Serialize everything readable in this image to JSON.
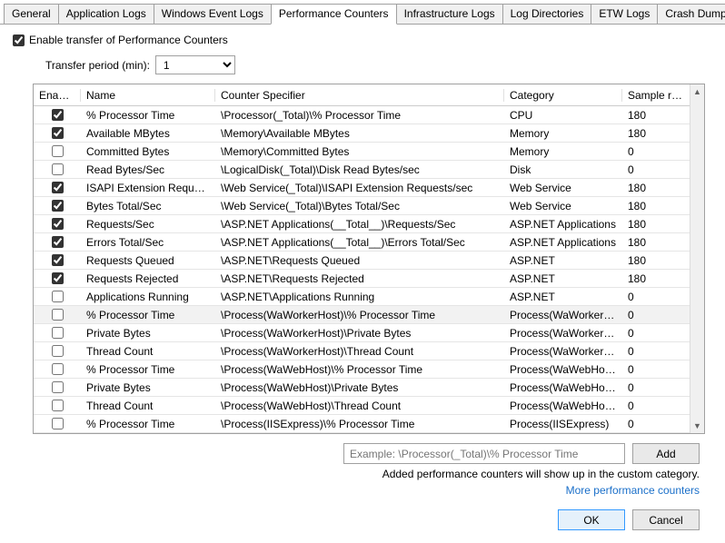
{
  "tabs": [
    "General",
    "Application Logs",
    "Windows Event Logs",
    "Performance Counters",
    "Infrastructure Logs",
    "Log Directories",
    "ETW Logs",
    "Crash Dumps"
  ],
  "active_tab_index": 3,
  "enable_checkbox_label": "Enable transfer of Performance Counters",
  "enable_checked": true,
  "transfer_label": "Transfer period (min):",
  "transfer_value": "1",
  "columns": {
    "enabled": "Enabled",
    "name": "Name",
    "spec": "Counter Specifier",
    "cat": "Category",
    "rate": "Sample rate (sec)"
  },
  "rows": [
    {
      "enabled": true,
      "name": "% Processor Time",
      "spec": "\\Processor(_Total)\\% Processor Time",
      "cat": "CPU",
      "rate": "180",
      "sel": false
    },
    {
      "enabled": true,
      "name": "Available MBytes",
      "spec": "\\Memory\\Available MBytes",
      "cat": "Memory",
      "rate": "180",
      "sel": false
    },
    {
      "enabled": false,
      "name": "Committed Bytes",
      "spec": "\\Memory\\Committed Bytes",
      "cat": "Memory",
      "rate": "0",
      "sel": false
    },
    {
      "enabled": false,
      "name": "Read Bytes/Sec",
      "spec": "\\LogicalDisk(_Total)\\Disk Read Bytes/sec",
      "cat": "Disk",
      "rate": "0",
      "sel": false
    },
    {
      "enabled": true,
      "name": "ISAPI Extension Requests/...",
      "spec": "\\Web Service(_Total)\\ISAPI Extension Requests/sec",
      "cat": "Web Service",
      "rate": "180",
      "sel": false
    },
    {
      "enabled": true,
      "name": "Bytes Total/Sec",
      "spec": "\\Web Service(_Total)\\Bytes Total/Sec",
      "cat": "Web Service",
      "rate": "180",
      "sel": false
    },
    {
      "enabled": true,
      "name": "Requests/Sec",
      "spec": "\\ASP.NET Applications(__Total__)\\Requests/Sec",
      "cat": "ASP.NET Applications",
      "rate": "180",
      "sel": false
    },
    {
      "enabled": true,
      "name": "Errors Total/Sec",
      "spec": "\\ASP.NET Applications(__Total__)\\Errors Total/Sec",
      "cat": "ASP.NET Applications",
      "rate": "180",
      "sel": false
    },
    {
      "enabled": true,
      "name": "Requests Queued",
      "spec": "\\ASP.NET\\Requests Queued",
      "cat": "ASP.NET",
      "rate": "180",
      "sel": false
    },
    {
      "enabled": true,
      "name": "Requests Rejected",
      "spec": "\\ASP.NET\\Requests Rejected",
      "cat": "ASP.NET",
      "rate": "180",
      "sel": false
    },
    {
      "enabled": false,
      "name": "Applications Running",
      "spec": "\\ASP.NET\\Applications Running",
      "cat": "ASP.NET",
      "rate": "0",
      "sel": false
    },
    {
      "enabled": false,
      "name": "% Processor Time",
      "spec": "\\Process(WaWorkerHost)\\% Processor Time",
      "cat": "Process(WaWorkerHost)",
      "rate": "0",
      "sel": true
    },
    {
      "enabled": false,
      "name": "Private Bytes",
      "spec": "\\Process(WaWorkerHost)\\Private Bytes",
      "cat": "Process(WaWorkerHost)",
      "rate": "0",
      "sel": false
    },
    {
      "enabled": false,
      "name": "Thread Count",
      "spec": "\\Process(WaWorkerHost)\\Thread Count",
      "cat": "Process(WaWorkerHost)",
      "rate": "0",
      "sel": false
    },
    {
      "enabled": false,
      "name": "% Processor Time",
      "spec": "\\Process(WaWebHost)\\% Processor Time",
      "cat": "Process(WaWebHost)",
      "rate": "0",
      "sel": false
    },
    {
      "enabled": false,
      "name": "Private Bytes",
      "spec": "\\Process(WaWebHost)\\Private Bytes",
      "cat": "Process(WaWebHost)",
      "rate": "0",
      "sel": false
    },
    {
      "enabled": false,
      "name": "Thread Count",
      "spec": "\\Process(WaWebHost)\\Thread Count",
      "cat": "Process(WaWebHost)",
      "rate": "0",
      "sel": false
    },
    {
      "enabled": false,
      "name": "% Processor Time",
      "spec": "\\Process(IISExpress)\\% Processor Time",
      "cat": "Process(IISExpress)",
      "rate": "0",
      "sel": false
    }
  ],
  "add_placeholder": "Example: \\Processor(_Total)\\% Processor Time",
  "add_button": "Add",
  "hint": "Added performance counters will show up in the custom category.",
  "link": "More performance counters",
  "ok": "OK",
  "cancel": "Cancel"
}
